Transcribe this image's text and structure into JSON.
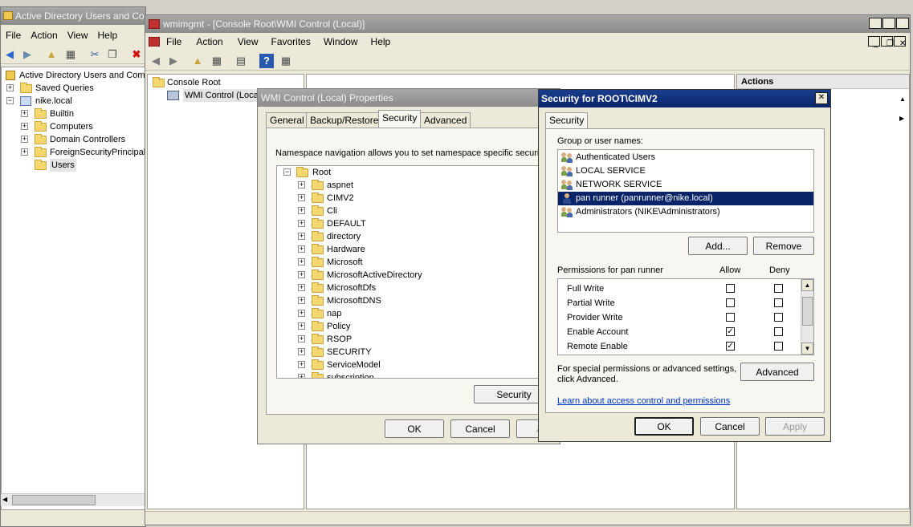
{
  "ad_window": {
    "title": "Active Directory Users and Co",
    "menu": [
      "File",
      "Action",
      "View",
      "Help"
    ],
    "tree": {
      "root": "Active Directory Users and Comp",
      "saved_queries": "Saved Queries",
      "domain": "nike.local",
      "children": [
        "Builtin",
        "Computers",
        "Domain Controllers",
        "ForeignSecurityPrincipals",
        "Users"
      ]
    }
  },
  "wmimgmt": {
    "title": "wmimgmt - [Console Root\\WMI Control (Local)]",
    "menu": [
      "File",
      "Action",
      "View",
      "Favorites",
      "Window",
      "Help"
    ],
    "tree": {
      "root": "Console Root",
      "child": "WMI Control (Local)"
    },
    "actions_header": "Actions"
  },
  "wmi_props": {
    "title": "WMI Control (Local) Properties",
    "tabs": [
      "General",
      "Backup/Restore",
      "Security",
      "Advanced"
    ],
    "selected_tab": "Security",
    "description": "Namespace navigation allows you to set namespace specific security",
    "namespace_root": "Root",
    "namespaces": [
      "aspnet",
      "CIMV2",
      "Cli",
      "DEFAULT",
      "directory",
      "Hardware",
      "Microsoft",
      "MicrosoftActiveDirectory",
      "MicrosoftDfs",
      "MicrosoftDNS",
      "nap",
      "Policy",
      "RSOP",
      "SECURITY",
      "ServiceModel",
      "subscription"
    ],
    "security_button": "Security",
    "ok": "OK",
    "cancel": "Cancel",
    "apply": "A"
  },
  "security_dialog": {
    "title": "Security for ROOT\\CIMV2",
    "tab": "Security",
    "group_label": "Group or user names:",
    "users": [
      "Authenticated Users",
      "LOCAL SERVICE",
      "NETWORK SERVICE",
      "pan runner (panrunner@nike.local)",
      "Administrators (NIKE\\Administrators)"
    ],
    "selected_user_index": 3,
    "add_button": "Add...",
    "remove_button": "Remove",
    "permissions_label": "Permissions for pan runner",
    "allow_header": "Allow",
    "deny_header": "Deny",
    "permissions": [
      {
        "name": "Full Write",
        "allow": false,
        "deny": false
      },
      {
        "name": "Partial Write",
        "allow": false,
        "deny": false
      },
      {
        "name": "Provider Write",
        "allow": false,
        "deny": false
      },
      {
        "name": "Enable Account",
        "allow": true,
        "deny": false
      },
      {
        "name": "Remote Enable",
        "allow": true,
        "deny": false
      }
    ],
    "special_text_1": "For special permissions or advanced settings,",
    "special_text_2": "click Advanced.",
    "advanced_button": "Advanced",
    "learn_link": "Learn about access control and permissions",
    "ok": "OK",
    "cancel": "Cancel",
    "apply": "Apply"
  },
  "colors": {
    "selection": "#0a246a",
    "active_title": "#0a246a",
    "link": "#0033cc"
  }
}
